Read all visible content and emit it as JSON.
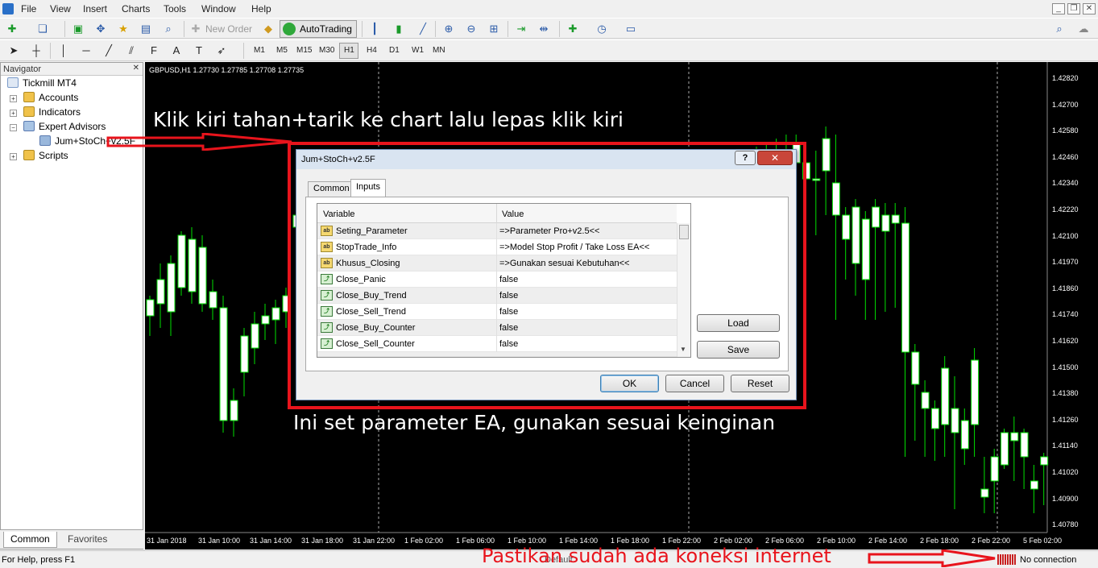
{
  "menu": [
    "File",
    "View",
    "Insert",
    "Charts",
    "Tools",
    "Window",
    "Help"
  ],
  "toolbar": {
    "new_order": "New Order",
    "autotrading": "AutoTrading",
    "timeframes": [
      "M1",
      "M5",
      "M15",
      "M30",
      "H1",
      "H4",
      "D1",
      "W1",
      "MN"
    ],
    "active_timeframe": "H1"
  },
  "navigator": {
    "title": "Navigator",
    "root": "Tickmill MT4",
    "items": [
      "Accounts",
      "Indicators",
      "Expert Advisors",
      "Jum+StoCh+v2.5F",
      "Scripts"
    ],
    "tabs": [
      "Common",
      "Favorites"
    ]
  },
  "chart": {
    "header": "GBPUSD,H1  1.27730 1.27785 1.27708 1.27735",
    "price_labels": [
      "1.42820",
      "1.42700",
      "1.42580",
      "1.42460",
      "1.42340",
      "1.42220",
      "1.42100",
      "1.41970",
      "1.41860",
      "1.41740",
      "1.41620",
      "1.41500",
      "1.41380",
      "1.41260",
      "1.41140",
      "1.41020",
      "1.40900",
      "1.40780"
    ],
    "time_labels": [
      "31 Jan 2018",
      "31 Jan 10:00",
      "31 Jan 14:00",
      "31 Jan 18:00",
      "31 Jan 22:00",
      "1 Feb 02:00",
      "1 Feb 06:00",
      "1 Feb 10:00",
      "1 Feb 14:00",
      "1 Feb 18:00",
      "1 Feb 22:00",
      "2 Feb 02:00",
      "2 Feb 06:00",
      "2 Feb 10:00",
      "2 Feb 14:00",
      "2 Feb 18:00",
      "2 Feb 22:00",
      "5 Feb 02:00"
    ]
  },
  "dialog": {
    "title": "Jum+StoCh+v2.5F",
    "tabs": [
      "Common",
      "Inputs"
    ],
    "active_tab": "Inputs",
    "col_variable": "Variable",
    "col_value": "Value",
    "rows": [
      {
        "type": "ab",
        "variable": "Seting_Parameter",
        "value": "=>Parameter Pro+v2.5<<"
      },
      {
        "type": "ab",
        "variable": "StopTrade_Info",
        "value": "=>Model Stop Profit / Take Loss EA<<"
      },
      {
        "type": "ab",
        "variable": "Khusus_Closing",
        "value": "=>Gunakan sesuai Kebutuhan<<"
      },
      {
        "type": "bool",
        "variable": "Close_Panic",
        "value": "false"
      },
      {
        "type": "bool",
        "variable": "Close_Buy_Trend",
        "value": "false"
      },
      {
        "type": "bool",
        "variable": "Close_Sell_Trend",
        "value": "false"
      },
      {
        "type": "bool",
        "variable": "Close_Buy_Counter",
        "value": "false"
      },
      {
        "type": "bool",
        "variable": "Close_Sell_Counter",
        "value": "false"
      }
    ],
    "load": "Load",
    "save": "Save",
    "ok": "OK",
    "cancel": "Cancel",
    "reset": "Reset",
    "help_glyph": "?",
    "close_glyph": "✕"
  },
  "annotations": {
    "top": "Klik kiri tahan+tarik ke chart lalu lepas klik kiri",
    "middle": "Ini set parameter EA, gunakan sesuai keinginan",
    "bottom": "Pastikan sudah ada koneksi internet"
  },
  "status": {
    "help": "For Help, press F1",
    "profile": "Default",
    "connection": "No connection"
  },
  "colors": {
    "annotation_red": "#e8141c",
    "bull_candle": "#ffffff",
    "wick": "#00e000",
    "chart_bg": "#000000"
  }
}
